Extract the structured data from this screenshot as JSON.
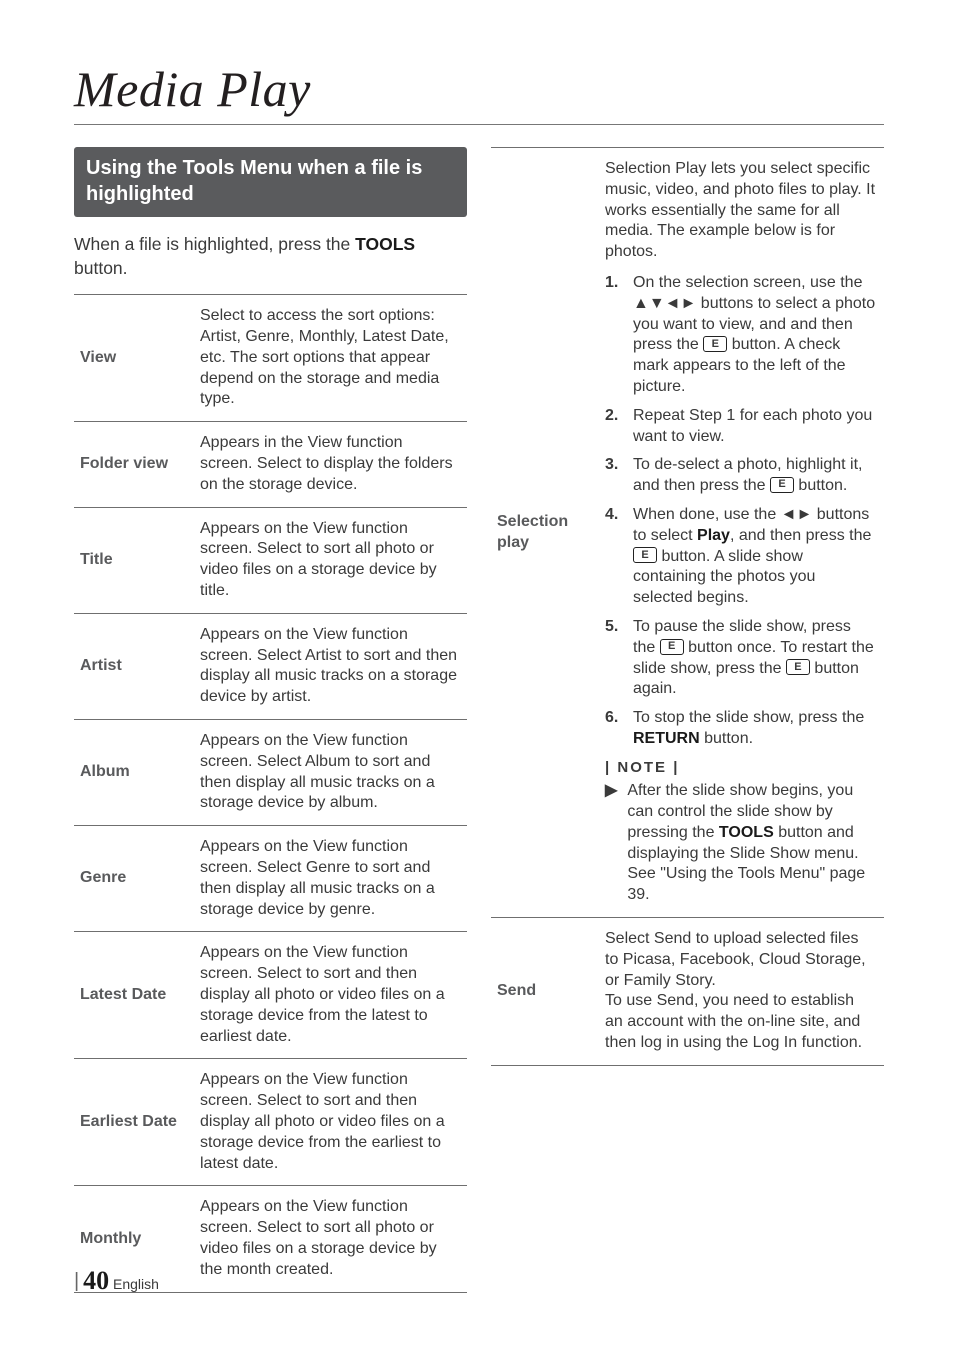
{
  "page_title": "Media Play",
  "section_heading": "Using the Tools Menu when a file is highlighted",
  "intro_before": "When a file is highlighted, press the ",
  "intro_bold": "TOOLS",
  "intro_after": " button.",
  "left_rows": [
    {
      "k": "View",
      "v": "Select to access the sort options: Artist, Genre, Monthly, Latest Date, etc. The sort options that appear depend on the storage and media type."
    },
    {
      "k": "Folder view",
      "v": "Appears in the View function screen. Select to display the folders on the storage device."
    },
    {
      "k": "Title",
      "v": "Appears on the View function screen. Select to sort all photo or video files on a storage device by title."
    },
    {
      "k": "Artist",
      "v": "Appears on the View function screen. Select Artist to sort and then display all music tracks on a storage device by artist."
    },
    {
      "k": "Album",
      "v": "Appears on the View function screen. Select Album to sort and then display all music tracks on a storage device by album."
    },
    {
      "k": "Genre",
      "v": "Appears on the View function screen. Select Genre to sort and then display all music tracks on a storage device by genre."
    },
    {
      "k": "Latest Date",
      "v": "Appears on the View function screen. Select to sort and then display all photo or video files on a storage device from the latest to earliest date."
    },
    {
      "k": "Earliest Date",
      "v": "Appears on the View function screen. Select to sort and then display all photo or video files on a storage device from the earliest to latest date."
    },
    {
      "k": "Monthly",
      "v": "Appears on the View function screen. Select to sort all photo or video files on a storage device by the month created."
    }
  ],
  "selection_play": {
    "label": "Selection play",
    "intro": "Selection Play lets you select specific music, video, and photo files to play. It works essentially the same for all media. The example below is for photos.",
    "steps": {
      "s1a": "On the selection screen, use the ▲▼◄► buttons to select a photo you want to view, and and then press the ",
      "s1b": " button. A check mark appears to the left of the picture.",
      "s2": "Repeat Step 1 for each photo you want to view.",
      "s3a": "To de-select a photo, highlight it, and then press the ",
      "s3b": " button.",
      "s4a": "When done, use the ◄► buttons to select ",
      "s4play": "Play",
      "s4b": ", and then press the ",
      "s4c": " button. A slide show containing the photos you selected begins.",
      "s5a": "To pause the slide show, press the ",
      "s5b": " button once. To restart the slide show, press the ",
      "s5c": " button again.",
      "s6a": "To stop the slide show, press the ",
      "s6return": "RETURN",
      "s6b": " button."
    },
    "note_label": "| NOTE |",
    "note_a": "After the slide show begins, you can control the slide show by pressing the ",
    "note_tools": "TOOLS",
    "note_b": " button and displaying the Slide Show menu. See \"Using the Tools Menu\" page 39."
  },
  "send": {
    "label": "Send",
    "body": "Select Send to upload selected files to Picasa, Facebook, Cloud Storage, or Family Story.\nTo use Send, you need to establish an account with the on-line site, and then log in using the Log In function."
  },
  "enter_glyph": "E",
  "footer": {
    "bar": "|",
    "num": "40",
    "lang": "English"
  }
}
